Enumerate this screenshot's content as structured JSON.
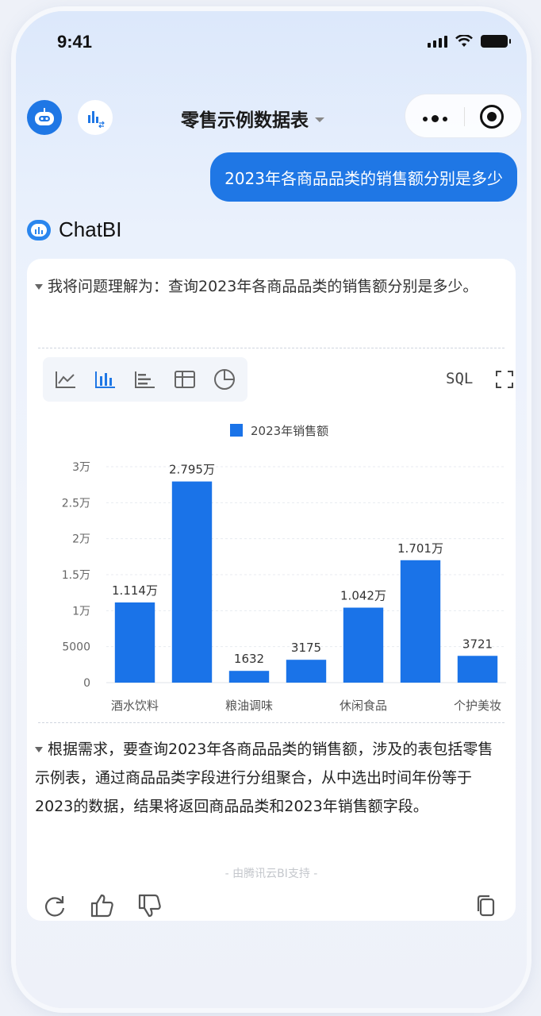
{
  "status": {
    "time": "9:41"
  },
  "nav": {
    "title": "零售示例数据表",
    "bot_icon": "robot-icon",
    "chart_icon": "chart-switch-icon",
    "more_icon": "more-dots-icon",
    "close_icon": "target-circle-icon"
  },
  "user_message": "2023年各商品品类的销售额分别是多少",
  "assistant": {
    "name": "ChatBI",
    "understanding": "我将问题理解为：查询2023年各商品品类的销售额分别是多少。",
    "toolbar": {
      "icons": [
        "line-chart-icon",
        "bar-chart-icon",
        "horizontal-bar-icon",
        "table-icon",
        "pie-chart-icon"
      ],
      "active": "bar-chart-icon",
      "sql_label": "SQL",
      "fullscreen_icon": "fullscreen-icon"
    },
    "explanation": "根据需求，要查询2023年各商品品类的销售额，涉及的表包括零售示例表，通过商品品类字段进行分组聚合，从中选出时间年份等于2023的数据，结果将返回商品品类和2023年销售额字段。",
    "footer_note": "- 由腾讯云BI支持 -",
    "actions": [
      "refresh-icon",
      "thumbs-up-icon",
      "thumbs-down-icon",
      "copy-icon"
    ]
  },
  "colors": {
    "accent": "#1f77e5",
    "bar": "#1a73e8"
  },
  "chart_data": {
    "type": "bar",
    "title": "",
    "legend": {
      "position": "top-center",
      "entries": [
        "2023年销售额"
      ]
    },
    "categories": [
      "酒水饮料",
      "",
      "粮油调味",
      "",
      "休闲食品",
      "",
      "个护美妆"
    ],
    "series": [
      {
        "name": "2023年销售额",
        "values": [
          11140,
          27950,
          1632,
          3175,
          10420,
          17010,
          3721
        ]
      }
    ],
    "data_labels": [
      "1.114万",
      "2.795万",
      "1632",
      "3175",
      "1.042万",
      "1.701万",
      "3721"
    ],
    "y_ticks": [
      "0",
      "5000",
      "1万",
      "1.5万",
      "2万",
      "2.5万",
      "3万"
    ],
    "ylim": [
      0,
      30000
    ],
    "grid": true
  }
}
